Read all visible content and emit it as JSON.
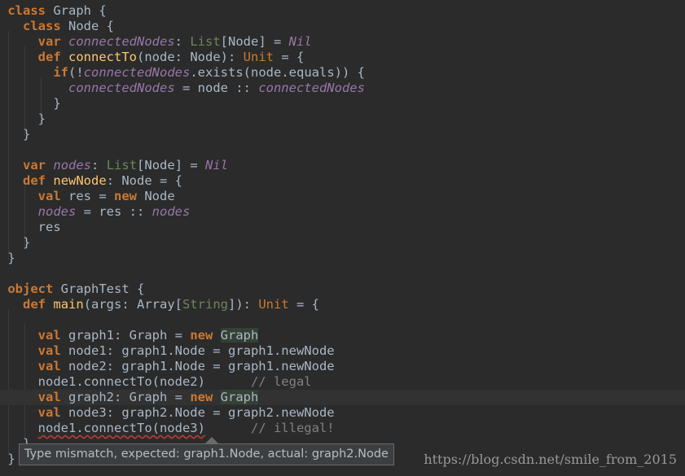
{
  "colors": {
    "background": "#2b2b2b",
    "keyword": "#cc7832",
    "field": "#9876aa",
    "function": "#ffc66d",
    "comment": "#808080",
    "plain": "#a9b7c6",
    "generic_type": "#6a8759",
    "highlight": "#344134",
    "error_underline": "#bc3f3c"
  },
  "code_lines": [
    {
      "current": false,
      "tokens": [
        {
          "t": "class",
          "c": "kw"
        },
        {
          "t": " Graph {",
          "c": "plain"
        }
      ]
    },
    {
      "current": false,
      "tokens": [
        {
          "t": "  ",
          "c": "plain"
        },
        {
          "t": "class",
          "c": "kw"
        },
        {
          "t": " Node {",
          "c": "plain"
        }
      ]
    },
    {
      "current": false,
      "tokens": [
        {
          "t": "    ",
          "c": "plain"
        },
        {
          "t": "var",
          "c": "kw"
        },
        {
          "t": " ",
          "c": "plain"
        },
        {
          "t": "connectedNodes",
          "c": "field"
        },
        {
          "t": ": ",
          "c": "plain"
        },
        {
          "t": "List",
          "c": "typeg"
        },
        {
          "t": "[Node] = ",
          "c": "plain"
        },
        {
          "t": "Nil",
          "c": "field"
        }
      ]
    },
    {
      "current": false,
      "tokens": [
        {
          "t": "    ",
          "c": "plain"
        },
        {
          "t": "def",
          "c": "kw"
        },
        {
          "t": " ",
          "c": "plain"
        },
        {
          "t": "connectTo",
          "c": "fn"
        },
        {
          "t": "(node: Node): ",
          "c": "plain"
        },
        {
          "t": "Unit",
          "c": "typeo"
        },
        {
          "t": " = {",
          "c": "plain"
        }
      ]
    },
    {
      "current": false,
      "tokens": [
        {
          "t": "      ",
          "c": "plain"
        },
        {
          "t": "if",
          "c": "kw"
        },
        {
          "t": "(!",
          "c": "plain"
        },
        {
          "t": "connectedNodes",
          "c": "field"
        },
        {
          "t": ".exists(node.equals)) {",
          "c": "plain"
        }
      ]
    },
    {
      "current": false,
      "tokens": [
        {
          "t": "        ",
          "c": "plain"
        },
        {
          "t": "connectedNodes",
          "c": "field"
        },
        {
          "t": " = node :: ",
          "c": "plain"
        },
        {
          "t": "connectedNodes",
          "c": "field"
        }
      ]
    },
    {
      "current": false,
      "tokens": [
        {
          "t": "      }",
          "c": "plain"
        }
      ]
    },
    {
      "current": false,
      "tokens": [
        {
          "t": "    }",
          "c": "plain"
        }
      ]
    },
    {
      "current": false,
      "tokens": [
        {
          "t": "  }",
          "c": "plain"
        }
      ]
    },
    {
      "current": false,
      "tokens": [
        {
          "t": "",
          "c": "plain"
        }
      ]
    },
    {
      "current": false,
      "tokens": [
        {
          "t": "  ",
          "c": "plain"
        },
        {
          "t": "var",
          "c": "kw"
        },
        {
          "t": " ",
          "c": "plain"
        },
        {
          "t": "nodes",
          "c": "field"
        },
        {
          "t": ": ",
          "c": "plain"
        },
        {
          "t": "List",
          "c": "typeg"
        },
        {
          "t": "[Node] = ",
          "c": "plain"
        },
        {
          "t": "Nil",
          "c": "field"
        }
      ]
    },
    {
      "current": false,
      "tokens": [
        {
          "t": "  ",
          "c": "plain"
        },
        {
          "t": "def",
          "c": "kw"
        },
        {
          "t": " ",
          "c": "plain"
        },
        {
          "t": "newNode",
          "c": "fn"
        },
        {
          "t": ": Node = {",
          "c": "plain"
        }
      ]
    },
    {
      "current": false,
      "tokens": [
        {
          "t": "    ",
          "c": "plain"
        },
        {
          "t": "val",
          "c": "kw"
        },
        {
          "t": " res = ",
          "c": "plain"
        },
        {
          "t": "new",
          "c": "kw"
        },
        {
          "t": " Node",
          "c": "plain"
        }
      ]
    },
    {
      "current": false,
      "tokens": [
        {
          "t": "    ",
          "c": "plain"
        },
        {
          "t": "nodes",
          "c": "field"
        },
        {
          "t": " = res :: ",
          "c": "plain"
        },
        {
          "t": "nodes",
          "c": "field"
        }
      ]
    },
    {
      "current": false,
      "tokens": [
        {
          "t": "    res",
          "c": "plain"
        }
      ]
    },
    {
      "current": false,
      "tokens": [
        {
          "t": "  }",
          "c": "plain"
        }
      ]
    },
    {
      "current": false,
      "tokens": [
        {
          "t": "}",
          "c": "plain"
        }
      ]
    },
    {
      "current": false,
      "tokens": [
        {
          "t": "",
          "c": "plain"
        }
      ]
    },
    {
      "current": false,
      "tokens": [
        {
          "t": "object",
          "c": "kw"
        },
        {
          "t": " GraphTest {",
          "c": "plain"
        }
      ]
    },
    {
      "current": false,
      "tokens": [
        {
          "t": "  ",
          "c": "plain"
        },
        {
          "t": "def",
          "c": "kw"
        },
        {
          "t": " ",
          "c": "plain"
        },
        {
          "t": "main",
          "c": "fn"
        },
        {
          "t": "(args: Array[",
          "c": "plain"
        },
        {
          "t": "String",
          "c": "typeg"
        },
        {
          "t": "]): ",
          "c": "plain"
        },
        {
          "t": "Unit",
          "c": "typeo"
        },
        {
          "t": " = {",
          "c": "plain"
        }
      ]
    },
    {
      "current": false,
      "tokens": [
        {
          "t": "",
          "c": "plain"
        }
      ]
    },
    {
      "current": false,
      "tokens": [
        {
          "t": "    ",
          "c": "plain"
        },
        {
          "t": "val",
          "c": "kw"
        },
        {
          "t": " graph1: Graph = ",
          "c": "plain"
        },
        {
          "t": "new",
          "c": "kw"
        },
        {
          "t": " ",
          "c": "plain"
        },
        {
          "t": "Graph",
          "c": "hl"
        }
      ]
    },
    {
      "current": false,
      "tokens": [
        {
          "t": "    ",
          "c": "plain"
        },
        {
          "t": "val",
          "c": "kw"
        },
        {
          "t": " node1: graph1.Node = graph1.newNode",
          "c": "plain"
        }
      ]
    },
    {
      "current": false,
      "tokens": [
        {
          "t": "    ",
          "c": "plain"
        },
        {
          "t": "val",
          "c": "kw"
        },
        {
          "t": " node2: graph1.Node = graph1.newNode",
          "c": "plain"
        }
      ]
    },
    {
      "current": false,
      "tokens": [
        {
          "t": "    node1.connectTo(node2)      ",
          "c": "plain"
        },
        {
          "t": "// legal",
          "c": "cmt"
        }
      ]
    },
    {
      "current": true,
      "tokens": [
        {
          "t": "    ",
          "c": "plain"
        },
        {
          "t": "val",
          "c": "kw"
        },
        {
          "t": " graph2: Graph = ",
          "c": "plain"
        },
        {
          "t": "new",
          "c": "kw"
        },
        {
          "t": " ",
          "c": "plain"
        },
        {
          "t": "Graph",
          "c": "hl"
        }
      ]
    },
    {
      "current": false,
      "tokens": [
        {
          "t": "    ",
          "c": "plain"
        },
        {
          "t": "val",
          "c": "kw"
        },
        {
          "t": " node3: graph2.Node = graph2.newNode",
          "c": "plain"
        }
      ]
    },
    {
      "current": false,
      "tokens": [
        {
          "t": "    ",
          "c": "plain"
        },
        {
          "t": "node1.connectTo(node3)",
          "c": "err"
        },
        {
          "t": "      ",
          "c": "plain"
        },
        {
          "t": "// illegal!",
          "c": "cmt"
        }
      ]
    },
    {
      "current": false,
      "tokens": [
        {
          "t": "  }",
          "c": "plain"
        }
      ]
    },
    {
      "current": false,
      "tokens": [
        {
          "t": "}",
          "c": "plain"
        }
      ]
    }
  ],
  "tooltip": {
    "text": "Type mismatch, expected: graph1.Node, actual: graph2.Node"
  },
  "watermark": {
    "text": "https://blog.csdn.net/smile_from_2015"
  }
}
